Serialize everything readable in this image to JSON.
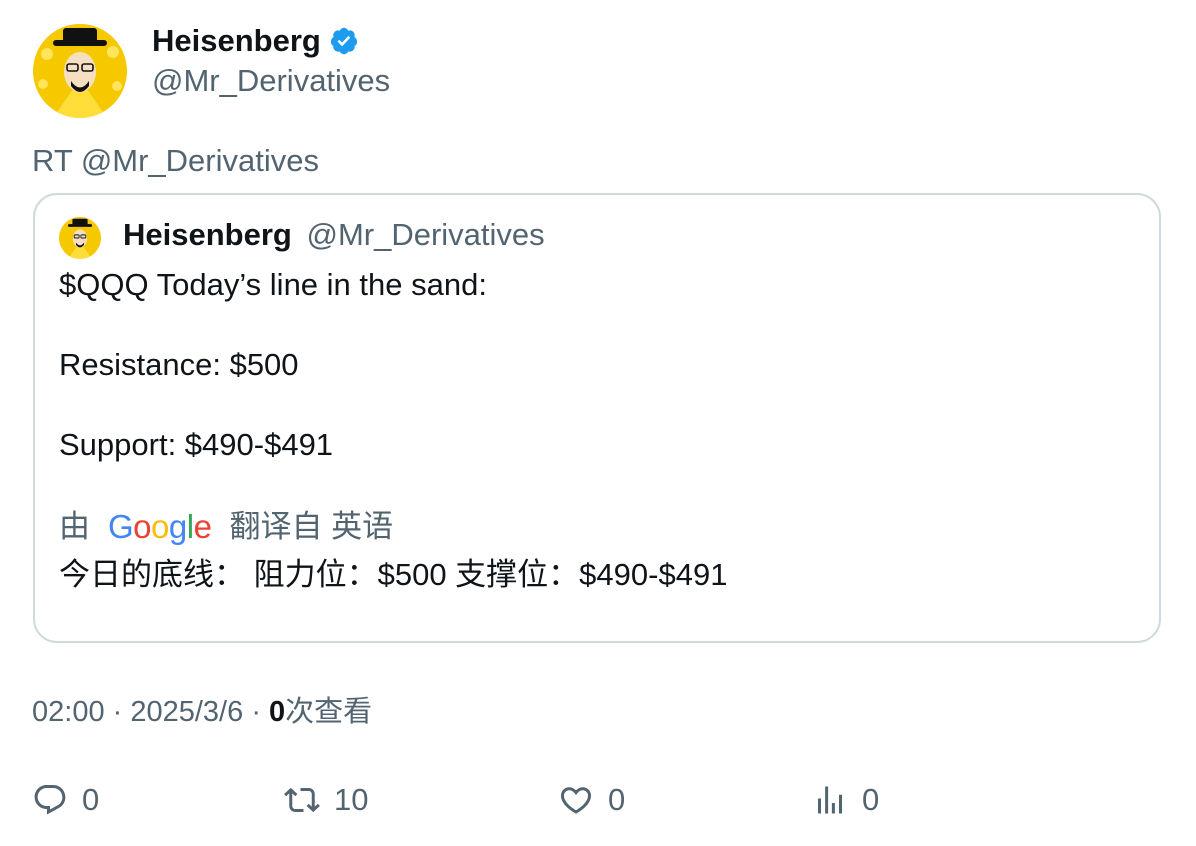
{
  "author": {
    "name": "Heisenberg",
    "handle": "@Mr_Derivatives",
    "verified_icon": "verified-badge-icon",
    "avatar_icon": "heisenberg-avatar"
  },
  "retweet_label": "RT @Mr_Derivatives",
  "quote": {
    "name": "Heisenberg",
    "handle": "@Mr_Derivatives",
    "lines": [
      "$QQQ Today’s line in the sand:",
      "Resistance: $500",
      "Support: $490-$491"
    ],
    "translation": {
      "prefix": "由",
      "provider": "Google",
      "suffix": "翻译自 英语",
      "text": "今日的底线： 阻力位：$500 支撑位：$490-$491"
    }
  },
  "meta": {
    "time": "02:00",
    "date": "2025/3/6",
    "views_count": "0",
    "views_label": "次查看"
  },
  "actions": {
    "replies": "0",
    "retweets": "10",
    "likes": "0",
    "views": "0"
  },
  "colors": {
    "accent": "#1d9bf0",
    "muted": "#536471",
    "border": "#cfd9de",
    "avatar_bg": "#f5c800"
  }
}
